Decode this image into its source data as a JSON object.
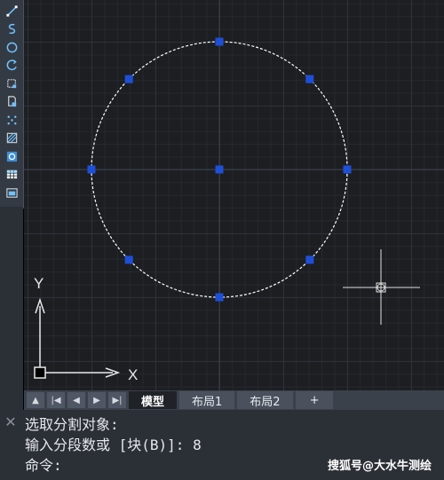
{
  "toolbar": {
    "tools": [
      {
        "icon": "line-icon"
      },
      {
        "icon": "spline-icon"
      },
      {
        "icon": "circle-icon"
      },
      {
        "icon": "arc-icon"
      },
      {
        "icon": "region-icon"
      },
      {
        "icon": "block-icon"
      },
      {
        "icon": "point-icon"
      },
      {
        "icon": "hatch-icon"
      },
      {
        "icon": "boundary-icon"
      },
      {
        "icon": "table-icon"
      },
      {
        "icon": "insert-image-icon"
      }
    ]
  },
  "canvas": {
    "ucs": {
      "x_label": "X",
      "y_label": "Y"
    },
    "circle_color": "#ffffff",
    "grip_color": "#1e4fd8",
    "divide_points": 8
  },
  "tabs": {
    "nav": [
      "▲",
      "|◀",
      "◀",
      "▶",
      "▶|"
    ],
    "items": [
      {
        "label": "模型",
        "active": true
      },
      {
        "label": "布局1",
        "active": false
      },
      {
        "label": "布局2",
        "active": false
      },
      {
        "label": "+",
        "active": false
      }
    ]
  },
  "command": {
    "close": "✕",
    "lines": [
      "选取分割对象:",
      "输入分段数或 [块(B)]: 8",
      "命令:"
    ]
  },
  "watermark": "搜狐号@大水牛测绘"
}
